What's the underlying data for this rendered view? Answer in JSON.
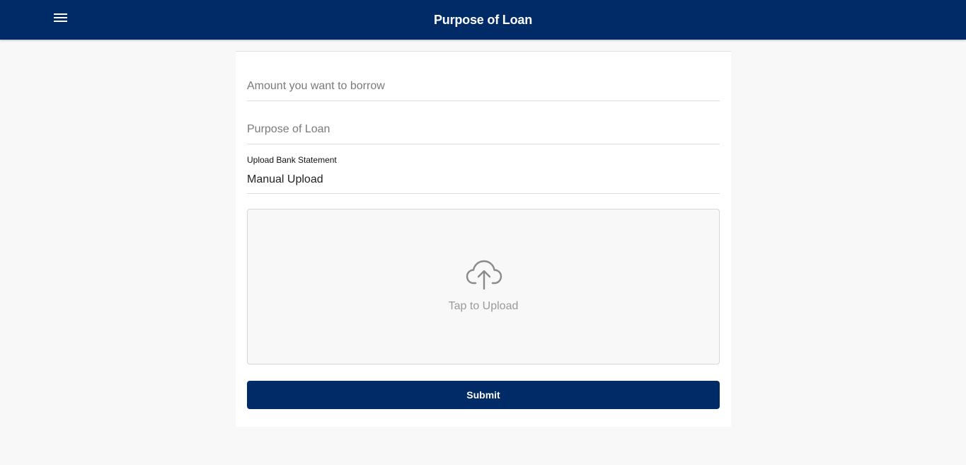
{
  "header": {
    "title": "Purpose of Loan",
    "menu_icon": "menu-icon",
    "background_color": "#002b66"
  },
  "form": {
    "amount_placeholder": "Amount you want to borrow",
    "purpose_placeholder": "Purpose of Loan",
    "bank_statement_label": "Upload Bank Statement",
    "bank_statement_value": "Manual Upload",
    "upload_icon": "cloud-upload-icon",
    "upload_text": "Tap to Upload",
    "submit_label": "Submit"
  }
}
